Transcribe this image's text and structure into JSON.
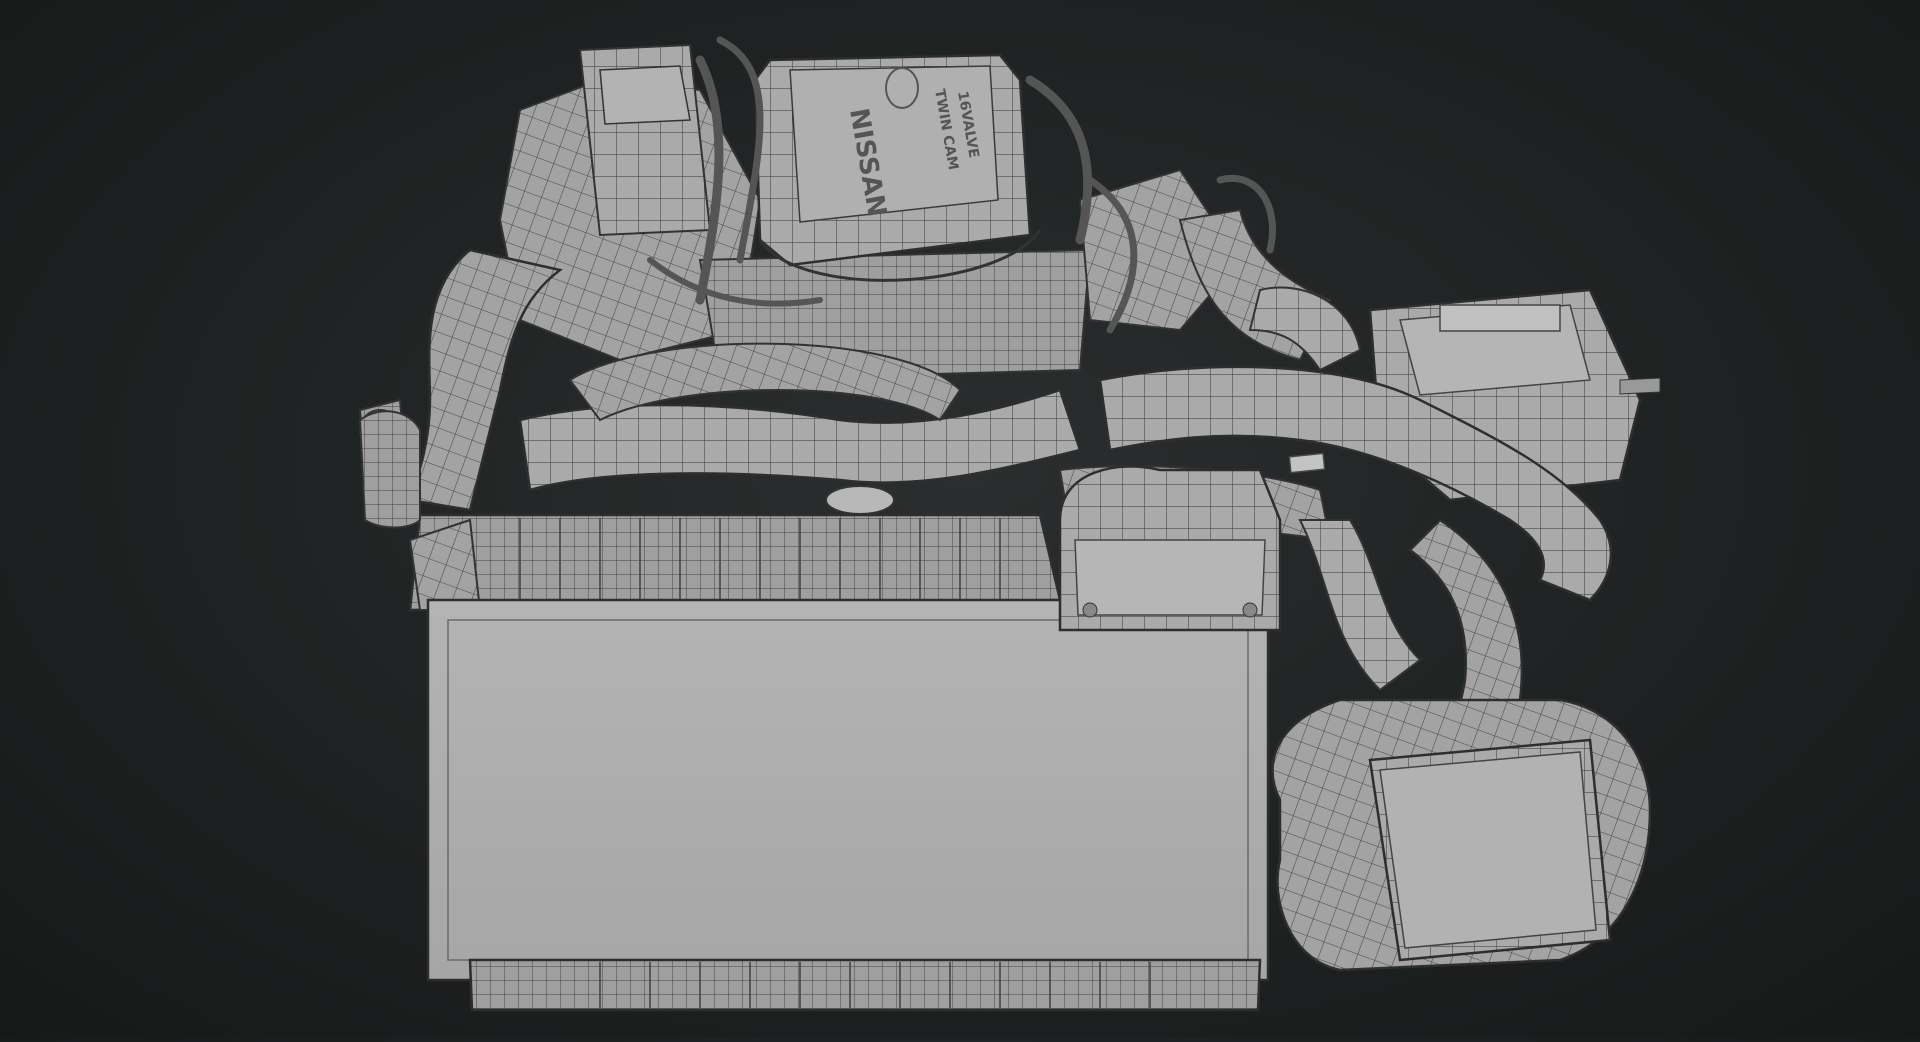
{
  "render": {
    "subject": "wireframe-engine-render",
    "cover_text_lines": [
      "NISSAN",
      "TWIN CAM",
      "16VALVE"
    ],
    "colors": {
      "background": "#1f2222",
      "mesh_fill": "#a9a9a9",
      "mesh_fill_light": "#bdbdbd",
      "mesh_fill_dark": "#8a8a8a",
      "wire": "#3a3a3a"
    }
  }
}
